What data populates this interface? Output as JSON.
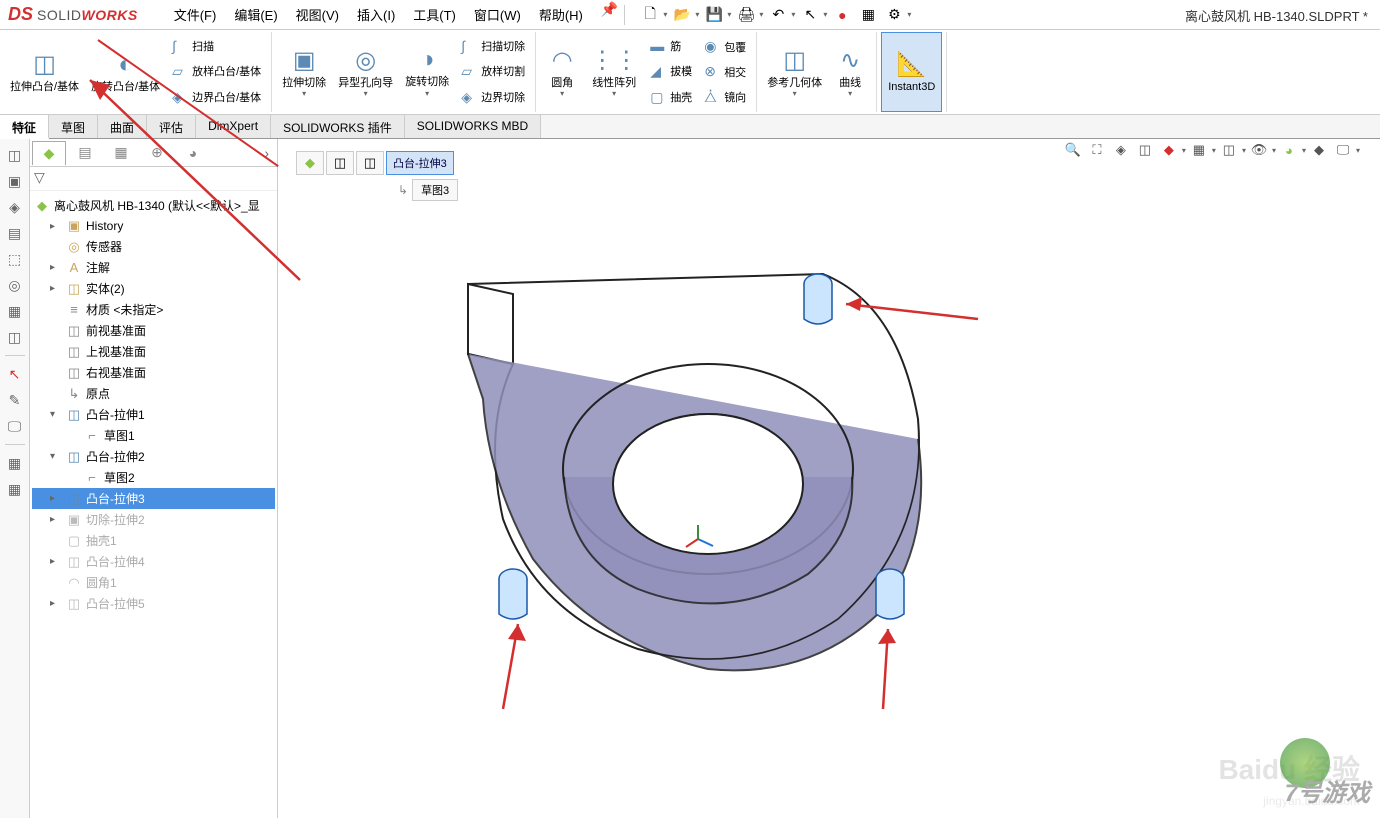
{
  "app": {
    "logo_solid": "SOLID",
    "logo_works": "WORKS",
    "doc_title": "离心鼓风机 HB-1340.SLDPRT *"
  },
  "menu": {
    "file": "文件(F)",
    "edit": "编辑(E)",
    "view": "视图(V)",
    "insert": "插入(I)",
    "tools": "工具(T)",
    "window": "窗口(W)",
    "help": "帮助(H)"
  },
  "ribbon": {
    "extrude_boss": "拉伸凸台/基体",
    "revolve_boss": "旋转凸台/基体",
    "swept_boss": "扫描",
    "loft_boss": "放样凸台/基体",
    "boundary_boss": "边界凸台/基体",
    "extrude_cut": "拉伸切除",
    "hole_wizard": "异型孔向导",
    "revolve_cut": "旋转切除",
    "swept_cut": "扫描切除",
    "loft_cut": "放样切割",
    "boundary_cut": "边界切除",
    "fillet": "圆角",
    "linear_pattern": "线性阵列",
    "rib": "筋",
    "draft": "拔模",
    "shell": "抽壳",
    "wrap": "包覆",
    "intersect": "相交",
    "mirror": "镜向",
    "ref_geom": "参考几何体",
    "curves": "曲线",
    "instant3d": "Instant3D"
  },
  "tabs": {
    "feature": "特征",
    "sketch": "草图",
    "surface": "曲面",
    "evaluate": "评估",
    "dimxpert": "DimXpert",
    "addins": "SOLIDWORKS 插件",
    "mbd": "SOLIDWORKS MBD"
  },
  "tree": {
    "root": "离心鼓风机 HB-1340  (默认<<默认>_显",
    "history": "History",
    "sensors": "传感器",
    "annotations": "注解",
    "solid_bodies": "实体(2)",
    "material": "材质 <未指定>",
    "front_plane": "前视基准面",
    "top_plane": "上视基准面",
    "right_plane": "右视基准面",
    "origin": "原点",
    "boss_extrude1": "凸台-拉伸1",
    "sketch1": "草图1",
    "boss_extrude2": "凸台-拉伸2",
    "sketch2": "草图2",
    "boss_extrude3": "凸台-拉伸3",
    "cut_extrude2": "切除-拉伸2",
    "shell1": "抽壳1",
    "boss_extrude4": "凸台-拉伸4",
    "fillet1": "圆角1",
    "boss_extrude5": "凸台-拉伸5"
  },
  "breadcrumb": {
    "selected": "凸台-拉伸3",
    "sub": "草图3"
  },
  "watermark": {
    "main": "Baidu 经验",
    "sub": "jingyan.baidu.com",
    "game": "7号游戏"
  }
}
